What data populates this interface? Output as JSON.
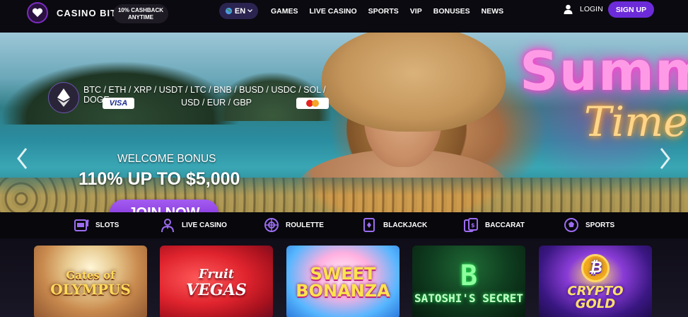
{
  "header": {
    "brand": "CASINO BIT",
    "cashback_line1": "10% CASHBACK",
    "cashback_line2": "ANYTIME",
    "language": "EN",
    "nav": [
      "GAMES",
      "LIVE CASINO",
      "SPORTS",
      "VIP",
      "BONUSES",
      "NEWS"
    ],
    "login_label": "LOGIN",
    "signup_label": "SIGN UP"
  },
  "banner": {
    "crypto_line": "BTC / ETH / XRP / USDT / LTC / BNB / BUSD / USDC / SOL / DOGE",
    "fiat_line": "USD / EUR / GBP",
    "visa_label": "VISA",
    "welcome": "WELCOME BONUS",
    "bonus": "110% UP TO $5,000",
    "join_label": "JOIN NOW",
    "neon_line1": "Summ",
    "neon_line2": "Time"
  },
  "categories": [
    {
      "label": "SLOTS",
      "icon": "slot-machine-icon"
    },
    {
      "label": "LIVE CASINO",
      "icon": "live-dealer-icon"
    },
    {
      "label": "ROULETTE",
      "icon": "roulette-icon"
    },
    {
      "label": "BLACKJACK",
      "icon": "playing-card-icon"
    },
    {
      "label": "BACCARAT",
      "icon": "cards-icon"
    },
    {
      "label": "SPORTS",
      "icon": "soccer-ball-icon"
    }
  ],
  "games": [
    {
      "title_line1": "Gates of",
      "title_line2": "OLYMPUS"
    },
    {
      "title_line1": "Fruit",
      "title_line2": "VEGAS"
    },
    {
      "title_line1": "SWEET",
      "title_line2": "BONANZA"
    },
    {
      "title_line1": "B",
      "title_line2": "SATOSHI'S SECRET"
    },
    {
      "title_line1": "CRYPTO",
      "title_line2": "GOLD"
    }
  ],
  "colors": {
    "accent": "#6c2bd9",
    "header_bg": "#0b0a10",
    "join_button": "#7b2bd6"
  }
}
